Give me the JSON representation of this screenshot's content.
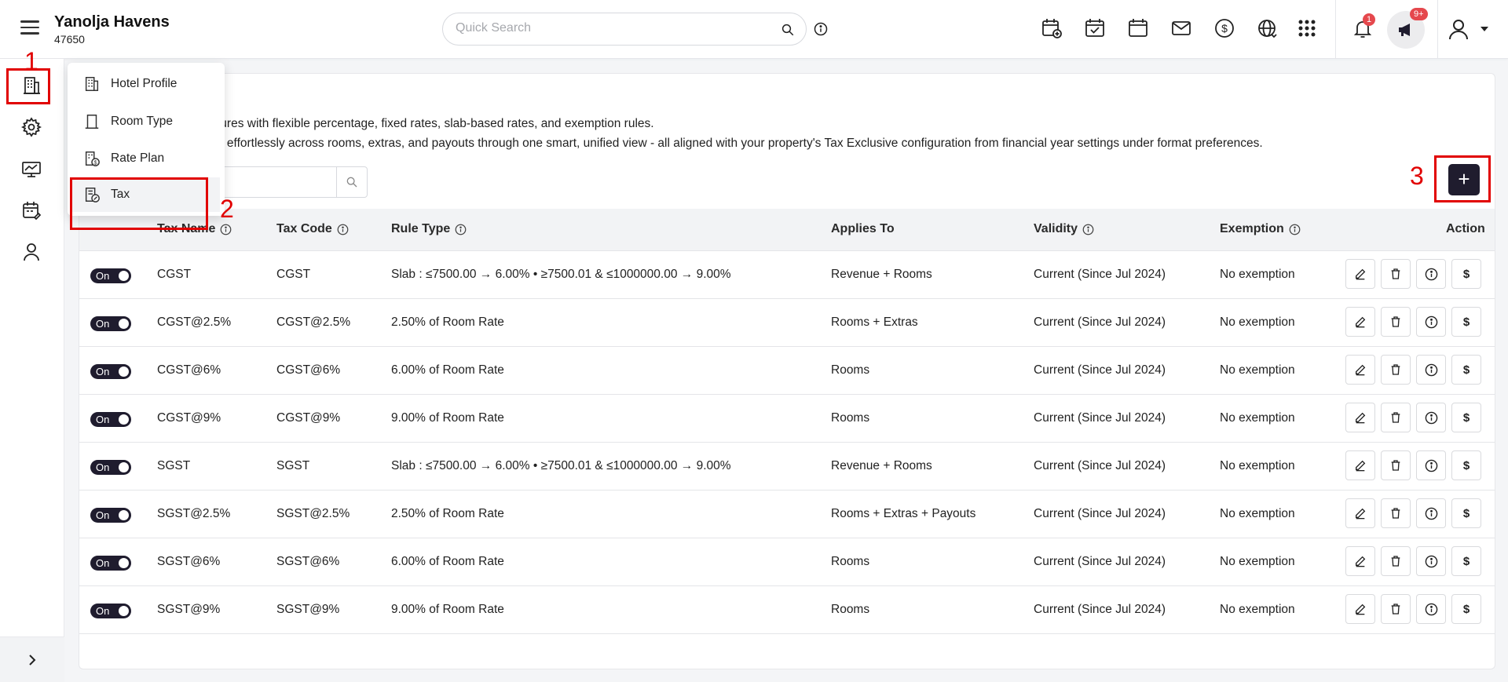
{
  "header": {
    "brand_name": "Yanolja Havens",
    "brand_id": "47650",
    "search_placeholder": "Quick Search",
    "notification_count": "1",
    "announcement_count": "9+"
  },
  "description": {
    "line1": "tures with flexible percentage, fixed rates, slab-based rates, and exemption rules.",
    "line2": "n effortlessly across rooms, extras, and payouts through one smart, unified view - all aligned with your property's Tax Exclusive configuration from financial year settings under format preferences."
  },
  "menu": {
    "items": [
      {
        "label": "Hotel Profile",
        "icon": "building-icon"
      },
      {
        "label": "Room Type",
        "icon": "door-icon"
      },
      {
        "label": "Rate Plan",
        "icon": "rate-icon"
      },
      {
        "label": "Tax",
        "icon": "tax-document-icon"
      }
    ]
  },
  "table": {
    "columns": [
      "Tax Name",
      "Tax Code",
      "Rule Type",
      "Applies To",
      "Validity",
      "Exemption",
      "Action"
    ],
    "rows": [
      {
        "status": "On",
        "name": "CGST",
        "code": "CGST",
        "rule": "Slab : ≤7500.00 → 6.00% • ≥7500.01 & ≤1000000.00 → 9.00%",
        "applies": "Revenue + Rooms",
        "validity": "Current (Since Jul 2024)",
        "exemption": "No exemption"
      },
      {
        "status": "On",
        "name": "CGST@2.5%",
        "code": "CGST@2.5%",
        "rule": "2.50% of Room Rate",
        "applies": "Rooms + Extras",
        "validity": "Current (Since Jul 2024)",
        "exemption": "No exemption"
      },
      {
        "status": "On",
        "name": "CGST@6%",
        "code": "CGST@6%",
        "rule": "6.00% of Room Rate",
        "applies": "Rooms",
        "validity": "Current (Since Jul 2024)",
        "exemption": "No exemption"
      },
      {
        "status": "On",
        "name": "CGST@9%",
        "code": "CGST@9%",
        "rule": "9.00% of Room Rate",
        "applies": "Rooms",
        "validity": "Current (Since Jul 2024)",
        "exemption": "No exemption"
      },
      {
        "status": "On",
        "name": "SGST",
        "code": "SGST",
        "rule": "Slab : ≤7500.00 → 6.00% • ≥7500.01 & ≤1000000.00 → 9.00%",
        "applies": "Revenue + Rooms",
        "validity": "Current (Since Jul 2024)",
        "exemption": "No exemption"
      },
      {
        "status": "On",
        "name": "SGST@2.5%",
        "code": "SGST@2.5%",
        "rule": "2.50% of Room Rate",
        "applies": "Rooms + Extras + Payouts",
        "validity": "Current (Since Jul 2024)",
        "exemption": "No exemption"
      },
      {
        "status": "On",
        "name": "SGST@6%",
        "code": "SGST@6%",
        "rule": "6.00% of Room Rate",
        "applies": "Rooms",
        "validity": "Current (Since Jul 2024)",
        "exemption": "No exemption"
      },
      {
        "status": "On",
        "name": "SGST@9%",
        "code": "SGST@9%",
        "rule": "9.00% of Room Rate",
        "applies": "Rooms",
        "validity": "Current (Since Jul 2024)",
        "exemption": "No exemption"
      }
    ],
    "action_price_label": "$"
  },
  "annotations": {
    "step1": "1",
    "step2": "2",
    "step3": "3"
  },
  "add_button_label": "+",
  "colors": {
    "accent_dark": "#1f1c2e",
    "annotation_red": "#e10000",
    "badge_red": "#e5484d"
  }
}
